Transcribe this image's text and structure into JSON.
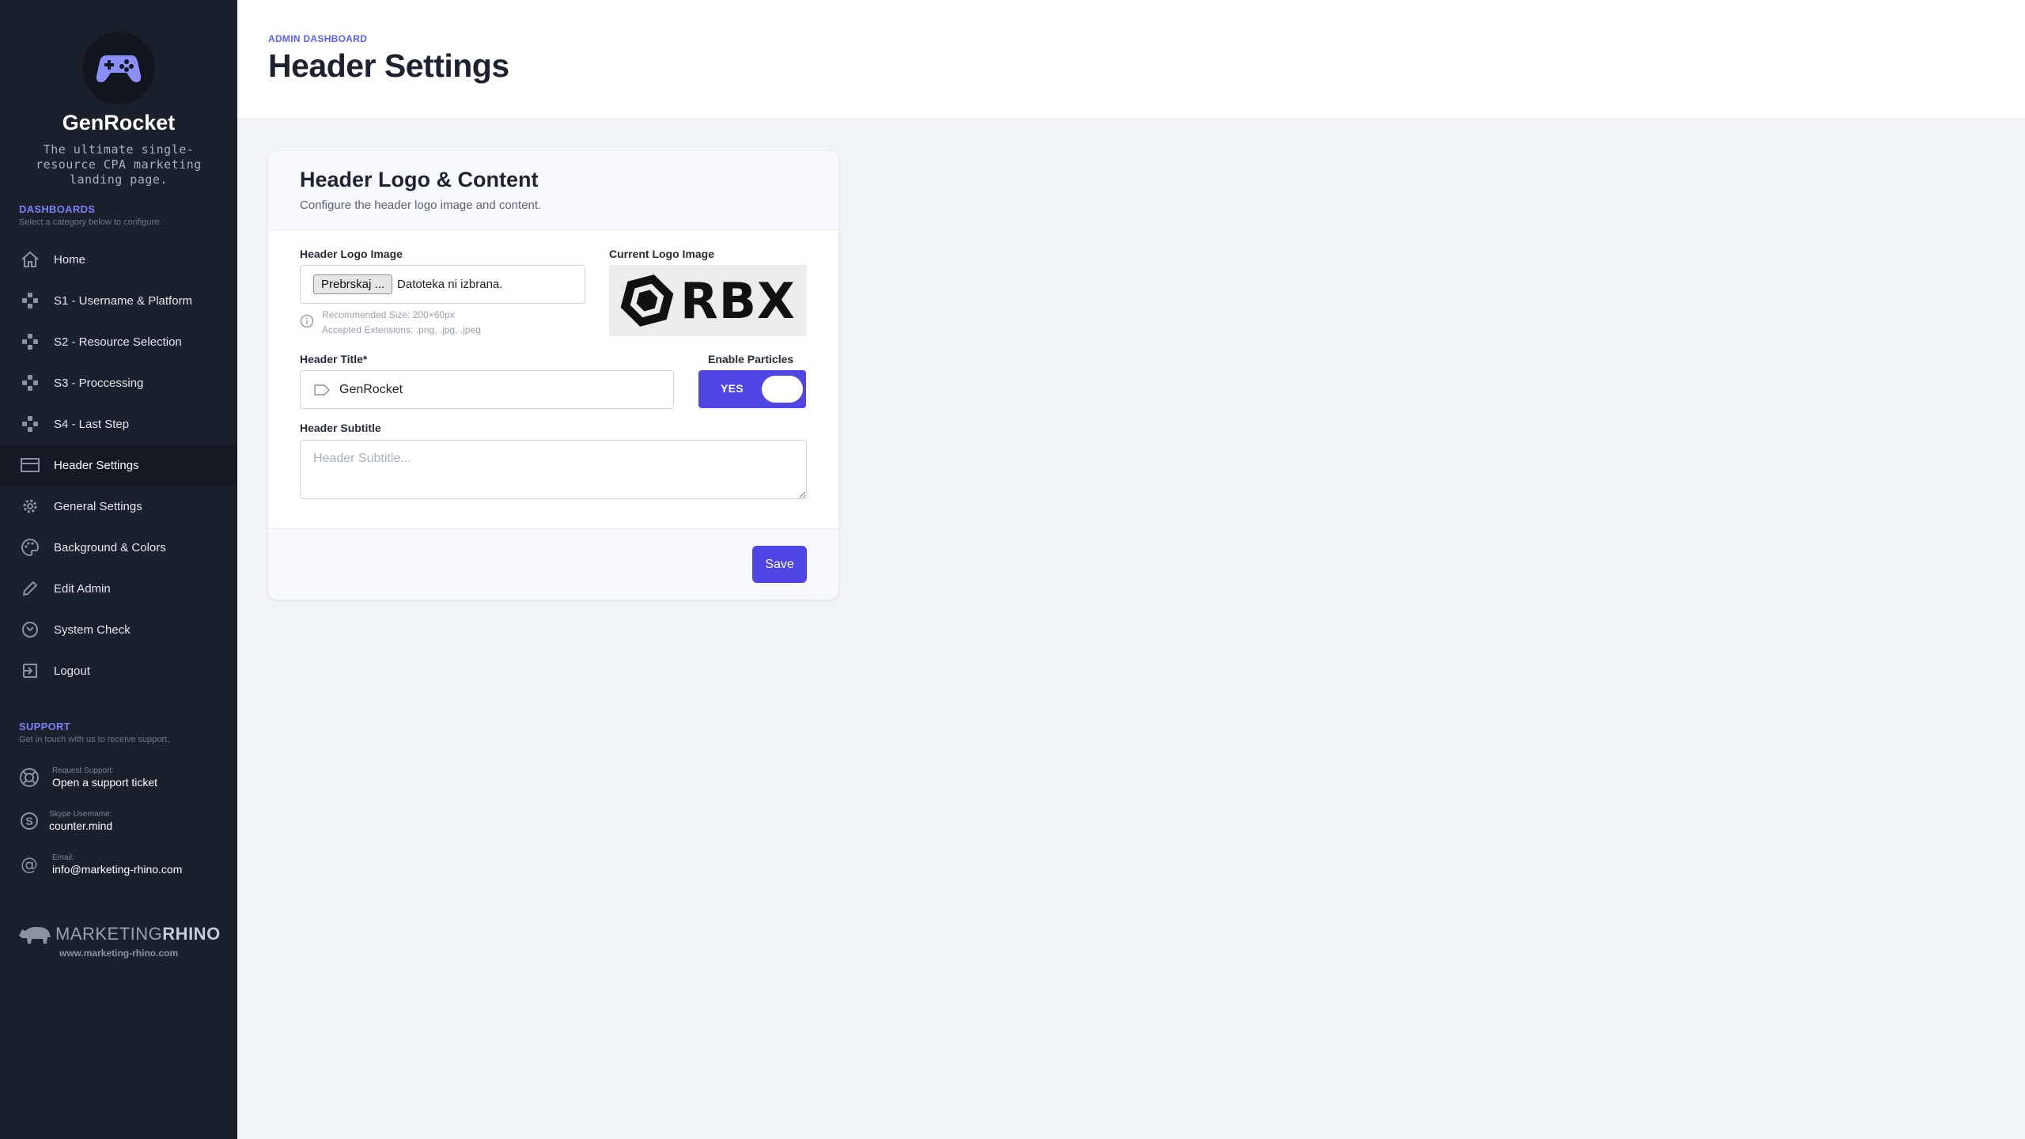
{
  "brand": {
    "name": "GenRocket",
    "description": "The ultimate single-resource CPA marketing landing page.",
    "logo_icon": "gamepad-icon"
  },
  "sidebar": {
    "dashboards_title": "DASHBOARDS",
    "dashboards_sub": "Select a category below to configure.",
    "items": [
      {
        "label": "Home",
        "icon": "home-icon"
      },
      {
        "label": "S1 - Username & Platform",
        "icon": "gamepad-icon"
      },
      {
        "label": "S2 - Resource Selection",
        "icon": "gamepad-icon"
      },
      {
        "label": "S3 - Proccessing",
        "icon": "gamepad-icon"
      },
      {
        "label": "S4 - Last Step",
        "icon": "gamepad-icon"
      },
      {
        "label": "Header Settings",
        "icon": "header-icon",
        "active": true
      },
      {
        "label": "General Settings",
        "icon": "gear-icon"
      },
      {
        "label": "Background & Colors",
        "icon": "palette-icon"
      },
      {
        "label": "Edit Admin",
        "icon": "pencil-icon"
      },
      {
        "label": "System Check",
        "icon": "system-check-icon"
      },
      {
        "label": "Logout",
        "icon": "logout-icon"
      }
    ],
    "support_title": "SUPPORT",
    "support_sub": "Get in touch with us to receive support.",
    "support": [
      {
        "caption": "Request Support:",
        "value": "Open a support ticket",
        "icon": "lifebuoy-icon"
      },
      {
        "caption": "Skype Username:",
        "value": "counter.mind",
        "icon": "skype-icon"
      },
      {
        "caption": "Email:",
        "value": "info@marketing-rhino.com",
        "icon": "at-icon"
      }
    ],
    "footer_logo_light": "MARKETING",
    "footer_logo_bold": "RHINO",
    "footer_url": "www.marketing-rhino.com"
  },
  "header": {
    "breadcrumb": "ADMIN DASHBOARD",
    "title": "Header Settings"
  },
  "card": {
    "title": "Header Logo & Content",
    "subtitle": "Configure the header logo image and content.",
    "logo_label": "Header Logo Image",
    "file_button": "Prebrskaj ...",
    "file_status": "Datoteka ni izbrana.",
    "hint_size": "Recommended Size: 200×60px",
    "hint_ext": "Accepted Extensions: .png, .jpg, .jpeg",
    "current_logo_label": "Current Logo Image",
    "current_logo_text": "RBX",
    "title_label": "Header Title*",
    "title_value": "GenRocket",
    "particles_label": "Enable Particles",
    "particles_state": "YES",
    "subtitle_label": "Header Subtitle",
    "subtitle_placeholder": "Header Subtitle...",
    "save_label": "Save"
  },
  "colors": {
    "accent": "#5046e5",
    "sidebar_bg": "#1b202d",
    "page_bg": "#f0f3f8"
  }
}
